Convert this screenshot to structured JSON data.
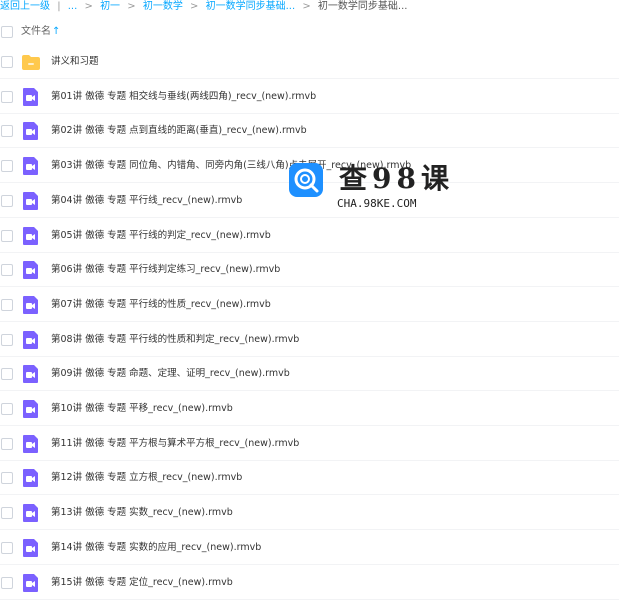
{
  "breadcrumb": {
    "back_label": "返回上一级",
    "separator": "|",
    "ellipsis": "...",
    "arrow": ">",
    "items": [
      "初一",
      "初一数学",
      "初一数学同步基础..."
    ],
    "current": "初一数学同步基础..."
  },
  "header": {
    "column_label": "文件名",
    "sort_icon": "↑",
    "sort_direction": "ascending"
  },
  "files": [
    {
      "name": "讲义和习题",
      "type": "folder"
    },
    {
      "name": "第01讲 傲德 专题 相交线与垂线(两线四角)_recv_(new).rmvb",
      "type": "video"
    },
    {
      "name": "第02讲 傲德 专题 点到直线的距离(垂直)_recv_(new).rmvb",
      "type": "video"
    },
    {
      "name": "第03讲 傲德 专题 同位角、内错角、同旁内角(三线八角)点击展开_recv_(new).rmvb",
      "type": "video"
    },
    {
      "name": "第04讲 傲德 专题 平行线_recv_(new).rmvb",
      "type": "video"
    },
    {
      "name": "第05讲 傲德 专题 平行线的判定_recv_(new).rmvb",
      "type": "video"
    },
    {
      "name": "第06讲 傲德 专题 平行线判定练习_recv_(new).rmvb",
      "type": "video"
    },
    {
      "name": "第07讲 傲德 专题 平行线的性质_recv_(new).rmvb",
      "type": "video"
    },
    {
      "name": "第08讲 傲德 专题 平行线的性质和判定_recv_(new).rmvb",
      "type": "video"
    },
    {
      "name": "第09讲 傲德 专题 命题、定理、证明_recv_(new).rmvb",
      "type": "video"
    },
    {
      "name": "第10讲 傲德 专题 平移_recv_(new).rmvb",
      "type": "video"
    },
    {
      "name": "第11讲 傲德 专题 平方根与算术平方根_recv_(new).rmvb",
      "type": "video"
    },
    {
      "name": "第12讲 傲德 专题 立方根_recv_(new).rmvb",
      "type": "video"
    },
    {
      "name": "第13讲 傲德 专题 实数_recv_(new).rmvb",
      "type": "video"
    },
    {
      "name": "第14讲 傲德 专题 实数的应用_recv_(new).rmvb",
      "type": "video"
    },
    {
      "name": "第15讲 傲德 专题 定位_recv_(new).rmvb",
      "type": "video"
    }
  ],
  "watermark": {
    "title": "查98课",
    "url": "CHA.98KE.COM"
  },
  "colors": {
    "link": "#06a7ff",
    "folder": "#ffc94d",
    "video": "#7b61ff",
    "logo": "#1e90ff"
  },
  "icons": {
    "folder": "folder-icon",
    "video": "video-file-icon",
    "sort": "arrow-up-icon",
    "logo": "search-logo-icon"
  }
}
